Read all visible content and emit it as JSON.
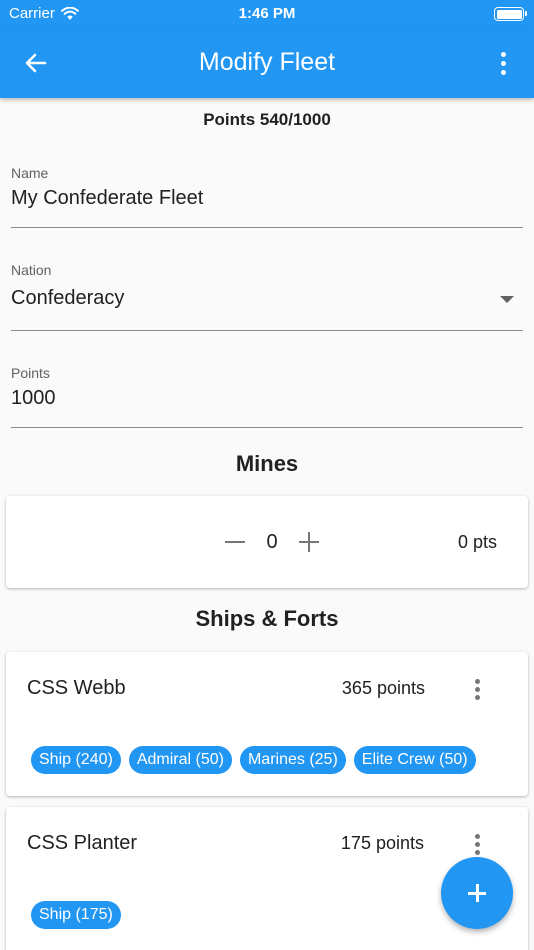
{
  "status_bar": {
    "carrier": "Carrier",
    "time": "1:46 PM",
    "wifi_icon": "wifi-icon",
    "battery_icon": "battery-icon"
  },
  "app_bar": {
    "title": "Modify Fleet",
    "back_icon": "arrow-left-icon",
    "menu_icon": "more-vert-icon",
    "color": "#2196f3"
  },
  "points_summary": "Points 540/1000",
  "form": {
    "name": {
      "label": "Name",
      "value": "My Confederate Fleet"
    },
    "nation": {
      "label": "Nation",
      "value": "Confederacy",
      "dropdown_icon": "dropdown-arrow-icon"
    },
    "points": {
      "label": "Points",
      "value": "1000"
    }
  },
  "mines": {
    "title": "Mines",
    "count": "0",
    "points": "0 pts",
    "decrement_icon": "minus-icon",
    "increment_icon": "plus-icon"
  },
  "ships_section": {
    "title": "Ships & Forts",
    "ships": [
      {
        "name": "CSS Webb",
        "points": "365 points",
        "chips": [
          "Ship (240)",
          "Admiral (50)",
          "Marines (25)",
          "Elite Crew (50)"
        ]
      },
      {
        "name": "CSS Planter",
        "points": "175 points",
        "chips": [
          "Ship (175)"
        ]
      }
    ]
  },
  "fab": {
    "icon": "plus-icon",
    "color": "#2196f3"
  }
}
